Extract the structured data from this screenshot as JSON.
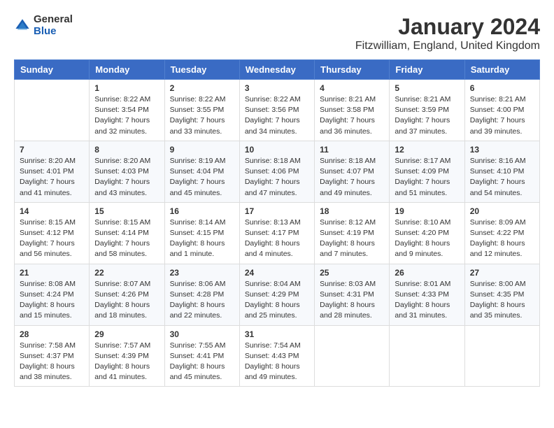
{
  "logo": {
    "general": "General",
    "blue": "Blue"
  },
  "title": "January 2024",
  "subtitle": "Fitzwilliam, England, United Kingdom",
  "weekdays": [
    "Sunday",
    "Monday",
    "Tuesday",
    "Wednesday",
    "Thursday",
    "Friday",
    "Saturday"
  ],
  "weeks": [
    [
      {
        "day": "",
        "sunrise": "",
        "sunset": "",
        "daylight": ""
      },
      {
        "day": "1",
        "sunrise": "Sunrise: 8:22 AM",
        "sunset": "Sunset: 3:54 PM",
        "daylight": "Daylight: 7 hours and 32 minutes."
      },
      {
        "day": "2",
        "sunrise": "Sunrise: 8:22 AM",
        "sunset": "Sunset: 3:55 PM",
        "daylight": "Daylight: 7 hours and 33 minutes."
      },
      {
        "day": "3",
        "sunrise": "Sunrise: 8:22 AM",
        "sunset": "Sunset: 3:56 PM",
        "daylight": "Daylight: 7 hours and 34 minutes."
      },
      {
        "day": "4",
        "sunrise": "Sunrise: 8:21 AM",
        "sunset": "Sunset: 3:58 PM",
        "daylight": "Daylight: 7 hours and 36 minutes."
      },
      {
        "day": "5",
        "sunrise": "Sunrise: 8:21 AM",
        "sunset": "Sunset: 3:59 PM",
        "daylight": "Daylight: 7 hours and 37 minutes."
      },
      {
        "day": "6",
        "sunrise": "Sunrise: 8:21 AM",
        "sunset": "Sunset: 4:00 PM",
        "daylight": "Daylight: 7 hours and 39 minutes."
      }
    ],
    [
      {
        "day": "7",
        "sunrise": "Sunrise: 8:20 AM",
        "sunset": "Sunset: 4:01 PM",
        "daylight": "Daylight: 7 hours and 41 minutes."
      },
      {
        "day": "8",
        "sunrise": "Sunrise: 8:20 AM",
        "sunset": "Sunset: 4:03 PM",
        "daylight": "Daylight: 7 hours and 43 minutes."
      },
      {
        "day": "9",
        "sunrise": "Sunrise: 8:19 AM",
        "sunset": "Sunset: 4:04 PM",
        "daylight": "Daylight: 7 hours and 45 minutes."
      },
      {
        "day": "10",
        "sunrise": "Sunrise: 8:18 AM",
        "sunset": "Sunset: 4:06 PM",
        "daylight": "Daylight: 7 hours and 47 minutes."
      },
      {
        "day": "11",
        "sunrise": "Sunrise: 8:18 AM",
        "sunset": "Sunset: 4:07 PM",
        "daylight": "Daylight: 7 hours and 49 minutes."
      },
      {
        "day": "12",
        "sunrise": "Sunrise: 8:17 AM",
        "sunset": "Sunset: 4:09 PM",
        "daylight": "Daylight: 7 hours and 51 minutes."
      },
      {
        "day": "13",
        "sunrise": "Sunrise: 8:16 AM",
        "sunset": "Sunset: 4:10 PM",
        "daylight": "Daylight: 7 hours and 54 minutes."
      }
    ],
    [
      {
        "day": "14",
        "sunrise": "Sunrise: 8:15 AM",
        "sunset": "Sunset: 4:12 PM",
        "daylight": "Daylight: 7 hours and 56 minutes."
      },
      {
        "day": "15",
        "sunrise": "Sunrise: 8:15 AM",
        "sunset": "Sunset: 4:14 PM",
        "daylight": "Daylight: 7 hours and 58 minutes."
      },
      {
        "day": "16",
        "sunrise": "Sunrise: 8:14 AM",
        "sunset": "Sunset: 4:15 PM",
        "daylight": "Daylight: 8 hours and 1 minute."
      },
      {
        "day": "17",
        "sunrise": "Sunrise: 8:13 AM",
        "sunset": "Sunset: 4:17 PM",
        "daylight": "Daylight: 8 hours and 4 minutes."
      },
      {
        "day": "18",
        "sunrise": "Sunrise: 8:12 AM",
        "sunset": "Sunset: 4:19 PM",
        "daylight": "Daylight: 8 hours and 7 minutes."
      },
      {
        "day": "19",
        "sunrise": "Sunrise: 8:10 AM",
        "sunset": "Sunset: 4:20 PM",
        "daylight": "Daylight: 8 hours and 9 minutes."
      },
      {
        "day": "20",
        "sunrise": "Sunrise: 8:09 AM",
        "sunset": "Sunset: 4:22 PM",
        "daylight": "Daylight: 8 hours and 12 minutes."
      }
    ],
    [
      {
        "day": "21",
        "sunrise": "Sunrise: 8:08 AM",
        "sunset": "Sunset: 4:24 PM",
        "daylight": "Daylight: 8 hours and 15 minutes."
      },
      {
        "day": "22",
        "sunrise": "Sunrise: 8:07 AM",
        "sunset": "Sunset: 4:26 PM",
        "daylight": "Daylight: 8 hours and 18 minutes."
      },
      {
        "day": "23",
        "sunrise": "Sunrise: 8:06 AM",
        "sunset": "Sunset: 4:28 PM",
        "daylight": "Daylight: 8 hours and 22 minutes."
      },
      {
        "day": "24",
        "sunrise": "Sunrise: 8:04 AM",
        "sunset": "Sunset: 4:29 PM",
        "daylight": "Daylight: 8 hours and 25 minutes."
      },
      {
        "day": "25",
        "sunrise": "Sunrise: 8:03 AM",
        "sunset": "Sunset: 4:31 PM",
        "daylight": "Daylight: 8 hours and 28 minutes."
      },
      {
        "day": "26",
        "sunrise": "Sunrise: 8:01 AM",
        "sunset": "Sunset: 4:33 PM",
        "daylight": "Daylight: 8 hours and 31 minutes."
      },
      {
        "day": "27",
        "sunrise": "Sunrise: 8:00 AM",
        "sunset": "Sunset: 4:35 PM",
        "daylight": "Daylight: 8 hours and 35 minutes."
      }
    ],
    [
      {
        "day": "28",
        "sunrise": "Sunrise: 7:58 AM",
        "sunset": "Sunset: 4:37 PM",
        "daylight": "Daylight: 8 hours and 38 minutes."
      },
      {
        "day": "29",
        "sunrise": "Sunrise: 7:57 AM",
        "sunset": "Sunset: 4:39 PM",
        "daylight": "Daylight: 8 hours and 41 minutes."
      },
      {
        "day": "30",
        "sunrise": "Sunrise: 7:55 AM",
        "sunset": "Sunset: 4:41 PM",
        "daylight": "Daylight: 8 hours and 45 minutes."
      },
      {
        "day": "31",
        "sunrise": "Sunrise: 7:54 AM",
        "sunset": "Sunset: 4:43 PM",
        "daylight": "Daylight: 8 hours and 49 minutes."
      },
      {
        "day": "",
        "sunrise": "",
        "sunset": "",
        "daylight": ""
      },
      {
        "day": "",
        "sunrise": "",
        "sunset": "",
        "daylight": ""
      },
      {
        "day": "",
        "sunrise": "",
        "sunset": "",
        "daylight": ""
      }
    ]
  ]
}
